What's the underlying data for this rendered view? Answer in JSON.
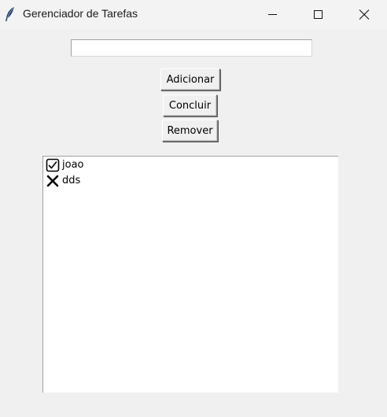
{
  "window": {
    "title": "Gerenciador de Tarefas"
  },
  "entry": {
    "value": ""
  },
  "buttons": {
    "add": "Adicionar",
    "complete": "Concluir",
    "remove": "Remover"
  },
  "tasks": [
    {
      "mark": "check-box-icon",
      "text": "joao"
    },
    {
      "mark": "x-mark-icon",
      "text": "dds"
    }
  ]
}
